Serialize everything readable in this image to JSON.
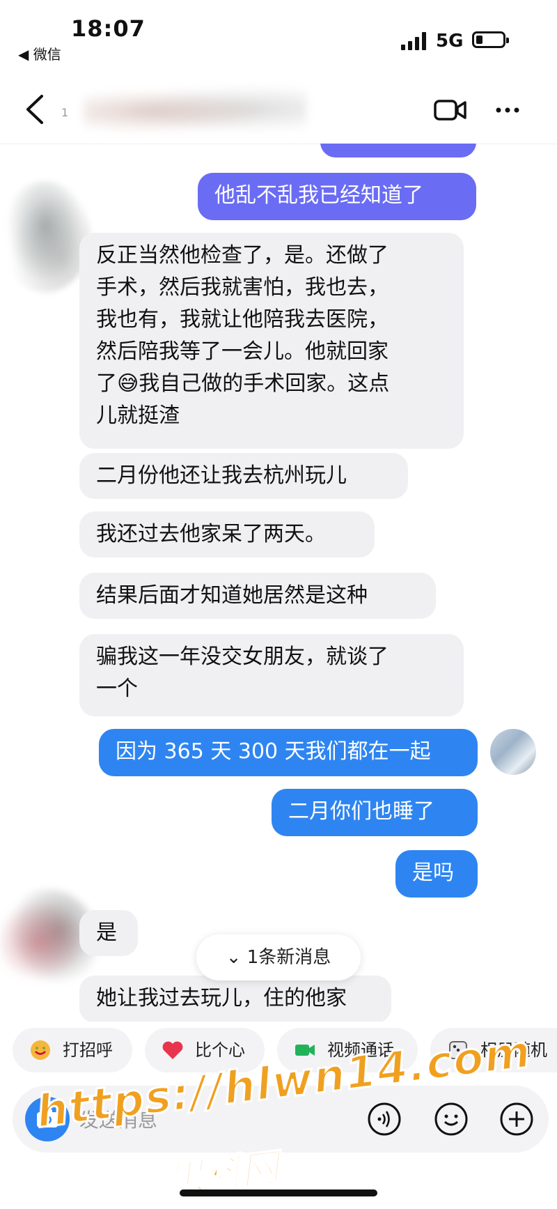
{
  "status_bar": {
    "time": "18:07",
    "back_app": "◀ 微信",
    "network": "5G"
  },
  "header": {
    "name_fragment": "1"
  },
  "messages": [
    {
      "side": "out",
      "text": "他乱不乱我已经知道了"
    },
    {
      "side": "in",
      "lines": [
        "反正当然他检查了，是。还做了",
        "手术，然后我就害怕，我也去，",
        "我也有，我就让他陪我去医院，",
        "然后陪我等了一会儿。他就回家",
        "了😅我自己做的手术回家。这点",
        "儿就挺渣"
      ]
    },
    {
      "side": "in",
      "text": "二月份他还让我去杭州玩儿"
    },
    {
      "side": "in",
      "text": "我还过去他家呆了两天。"
    },
    {
      "side": "in",
      "text": "结果后面才知道她居然是这种"
    },
    {
      "side": "in",
      "lines": [
        "骗我这一年没交女朋友，就谈了",
        "一个"
      ]
    },
    {
      "side": "out",
      "text": "因为 365 天 300 天我们都在一起"
    },
    {
      "side": "out",
      "text": "二月你们也睡了"
    },
    {
      "side": "out",
      "text": "是吗"
    },
    {
      "side": "in",
      "text": "是"
    },
    {
      "side": "in",
      "text": "她让我过去玩儿，住的他家"
    }
  ],
  "new_message_pill": "⌄ 1条新消息",
  "quick_actions": [
    "打招呼",
    "比个心",
    "视频通话",
    "相册随机"
  ],
  "input": {
    "placeholder": "发送消息"
  },
  "watermark": {
    "url": "https://hlwn14.com",
    "site": "黑料网"
  },
  "colors": {
    "outgoing_purple": "#6a6cf4",
    "outgoing_blue": "#2e85f2",
    "incoming": "#f0f0f3",
    "watermark": "#f0a020"
  }
}
